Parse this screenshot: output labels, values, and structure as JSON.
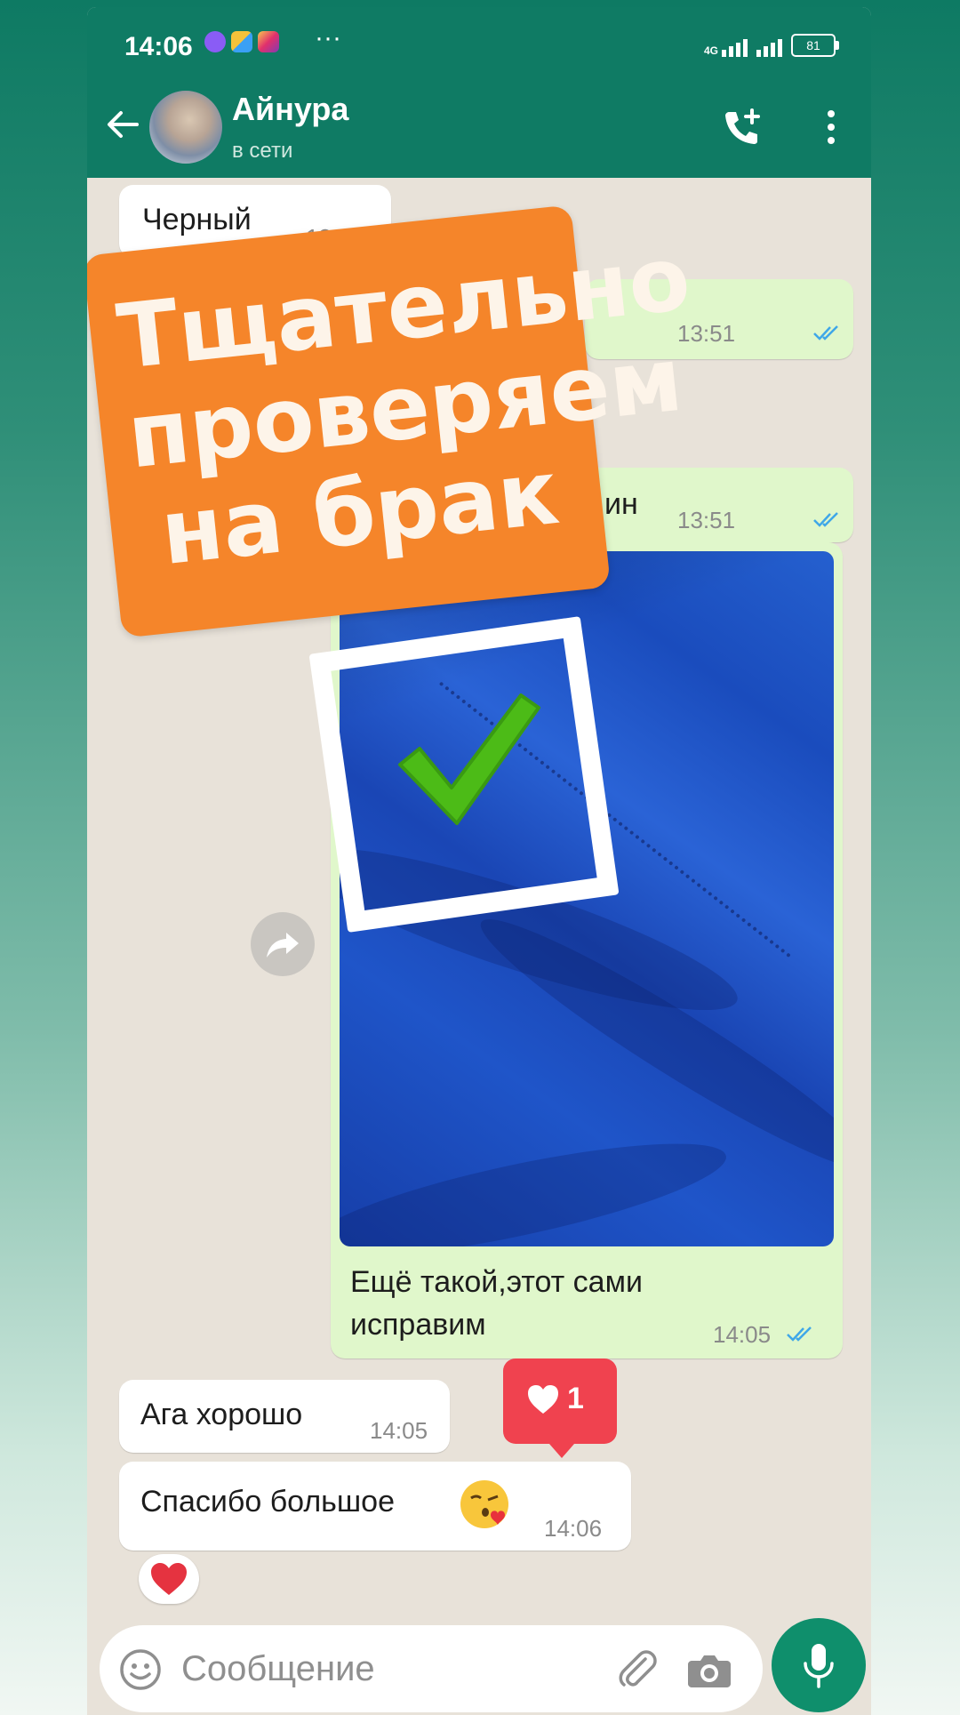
{
  "status_bar": {
    "time": "14:06",
    "more": "···",
    "network": "4G",
    "battery": "81"
  },
  "header": {
    "contact_name": "Айнура",
    "contact_status": "в сети"
  },
  "messages": [
    {
      "text": "Черный",
      "time": "13:51",
      "direction": "in"
    },
    {
      "text": "",
      "time": "13:51",
      "direction": "out"
    },
    {
      "text": "ин",
      "time": "13:51",
      "direction": "out"
    },
    {
      "text": "Ещё такой,этот сами исправим",
      "time": "14:05",
      "direction": "out"
    },
    {
      "text": "Ага хорошо",
      "time": "14:05",
      "direction": "in"
    },
    {
      "text": "Спасибо большое",
      "time": "14:06",
      "direction": "in"
    }
  ],
  "overlay": {
    "text": "Тщательно проверяем на брак"
  },
  "reaction": {
    "count": "1"
  },
  "composer": {
    "placeholder": "Сообщение"
  },
  "colors": {
    "header": "#0f7b64",
    "outgoing_bubble": "#e0f7cb",
    "overlay_label": "#f5852a",
    "checkmark": "#4cbb17",
    "reaction_badge": "#f0424f",
    "mic_button": "#0f8f6c"
  }
}
